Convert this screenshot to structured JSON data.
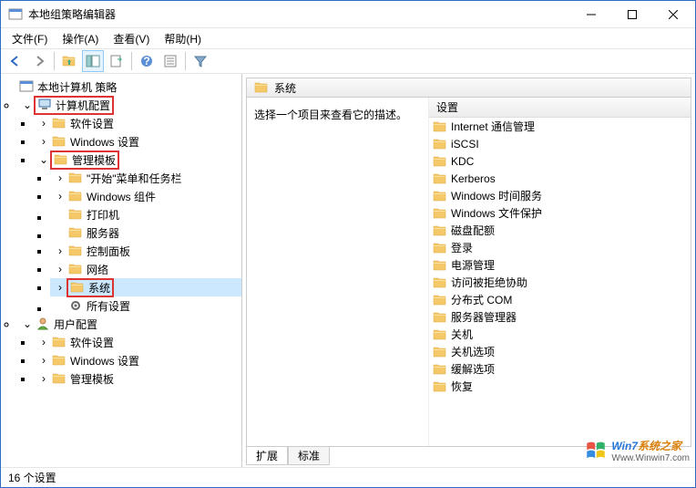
{
  "window": {
    "title": "本地组策略编辑器"
  },
  "menu": {
    "file": "文件(F)",
    "action": "操作(A)",
    "view": "查看(V)",
    "help": "帮助(H)"
  },
  "tree": {
    "root": "本地计算机 策略",
    "computer_config": "计算机配置",
    "software_settings": "软件设置",
    "windows_settings": "Windows 设置",
    "admin_templates": "管理模板",
    "start_taskbar": "\"开始\"菜单和任务栏",
    "windows_components": "Windows 组件",
    "printers": "打印机",
    "servers": "服务器",
    "control_panel": "控制面板",
    "network": "网络",
    "system": "系统",
    "all_settings": "所有设置",
    "user_config": "用户配置",
    "u_software": "软件设置",
    "u_windows": "Windows 设置",
    "u_admin": "管理模板"
  },
  "detail": {
    "header": "系统",
    "prompt": "选择一个项目来查看它的描述。",
    "settings_col": "设置",
    "items": [
      "Internet 通信管理",
      "iSCSI",
      "KDC",
      "Kerberos",
      "Windows 时间服务",
      "Windows 文件保护",
      "磁盘配额",
      "登录",
      "电源管理",
      "访问被拒绝协助",
      "分布式 COM",
      "服务器管理器",
      "关机",
      "关机选项",
      "缓解选项",
      "恢复"
    ]
  },
  "tabs": {
    "extended": "扩展",
    "standard": "标准"
  },
  "status": "16 个设置",
  "watermark": {
    "line1a": "Win7",
    "line1b": "系统之家",
    "line2": "Www.Winwin7.com"
  }
}
